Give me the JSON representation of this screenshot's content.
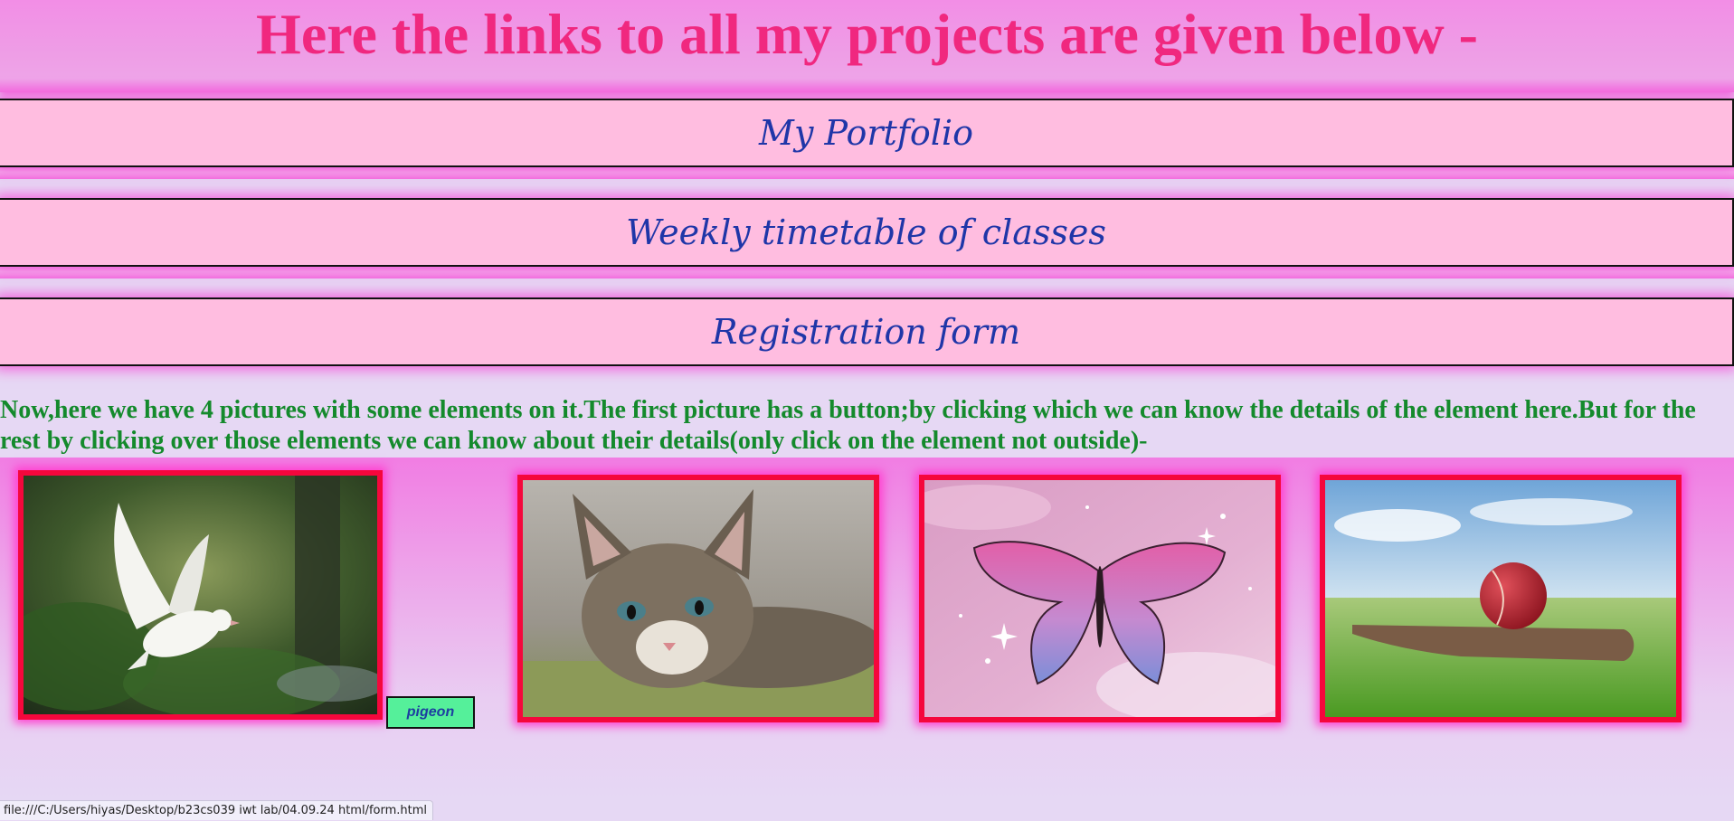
{
  "header": {
    "title": "Here the links to all my projects are given below -"
  },
  "links": [
    {
      "label": "My Portfolio"
    },
    {
      "label": "Weekly timetable of classes"
    },
    {
      "label": "Registration form"
    }
  ],
  "description": "Now,here we have 4 pictures with some elements on it.The first picture has a button;by clicking which we can know the details of the element here.But for the rest by clicking over those elements we can know about their details(only click on the element not outside)-",
  "gallery": {
    "pictures": [
      "pigeon",
      "cat",
      "butterfly",
      "cricket ball"
    ],
    "button_label": "pigeon"
  },
  "status_bar": {
    "url": "file:///C:/Users/hiyas/Desktop/b23cs039 iwt lab/04.09.24 html/form.html"
  },
  "colors": {
    "title": "#f0287f",
    "link_text": "#1f36a8",
    "link_bg": "#ffbde0",
    "description": "#148a2c",
    "picture_border": "#f5073c",
    "button_bg": "#55f09a"
  }
}
